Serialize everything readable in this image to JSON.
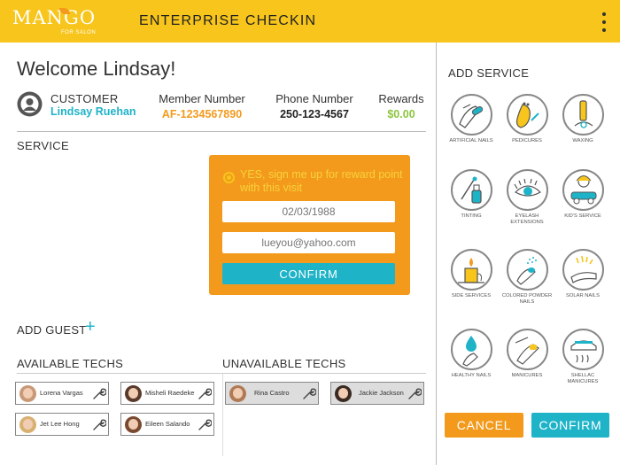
{
  "header": {
    "logo_text": "MANGO",
    "logo_subtext": "FOR SALON",
    "title": "ENTERPRISE CHECKIN"
  },
  "welcome": "Welcome Lindsay!",
  "customer": {
    "label": "CUSTOMER",
    "name": "Lindsay Ruehan",
    "member_label": "Member Number",
    "member_number": "AF-1234567890",
    "phone_label": "Phone Number",
    "phone_number": "250-123-4567",
    "rewards_label": "Rewards",
    "rewards_value": "$0.00"
  },
  "service_section": {
    "label": "SERVICE"
  },
  "reward_signup": {
    "text": "YES, sign me up for reward point with this visit",
    "birthday_placeholder": "02/03/1988",
    "email_placeholder": "lueyou@yahoo.com",
    "confirm_label": "CONFIRM"
  },
  "add_guest_label": "ADD GUEST",
  "available_techs": {
    "label": "AVAILABLE TECHS",
    "items": [
      {
        "name": "Lorena Vargas"
      },
      {
        "name": "Misheli Raedeke"
      },
      {
        "name": "Jet Lee Hong"
      },
      {
        "name": "Eileen Salando"
      }
    ]
  },
  "unavailable_techs": {
    "label": "UNAVAILABLE TECHS",
    "items": [
      {
        "name": "Rina Castro"
      },
      {
        "name": "Jackie Jackson"
      }
    ]
  },
  "add_service": {
    "label": "ADD SERVICE",
    "items": [
      {
        "label": "ARTIFICIAL NAILS",
        "icon": "artificial-nails-icon"
      },
      {
        "label": "PEDICURES",
        "icon": "pedicure-icon"
      },
      {
        "label": "WAXING",
        "icon": "waxing-icon"
      },
      {
        "label": "TINTING",
        "icon": "tinting-icon"
      },
      {
        "label": "EYELASH EXTENSIONS",
        "icon": "eyelash-icon"
      },
      {
        "label": "KID'S SERVICE",
        "icon": "kids-service-icon"
      },
      {
        "label": "SIDE SERVICES",
        "icon": "candle-icon"
      },
      {
        "label": "COLORED POWDER NAILS",
        "icon": "powder-nails-icon"
      },
      {
        "label": "SOLAR NAILS",
        "icon": "solar-nails-icon"
      },
      {
        "label": "HEALTHY NAILS",
        "icon": "healthy-nails-icon"
      },
      {
        "label": "MANICURES",
        "icon": "manicure-icon"
      },
      {
        "label": "SHELLAC MANICURES",
        "icon": "shellac-icon"
      }
    ]
  },
  "footer": {
    "cancel_label": "CANCEL",
    "confirm_label": "CONFIRM"
  },
  "colors": {
    "header": "#f7c51b",
    "orange": "#f39a1c",
    "teal": "#1fb3c8",
    "green": "#8cc63f"
  }
}
